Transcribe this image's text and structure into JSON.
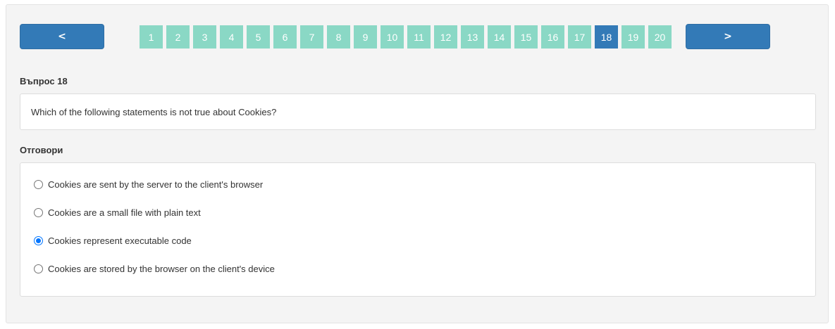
{
  "navigation": {
    "prev_label": "<",
    "next_label": ">",
    "pages": [
      "1",
      "2",
      "3",
      "4",
      "5",
      "6",
      "7",
      "8",
      "9",
      "10",
      "11",
      "12",
      "13",
      "14",
      "15",
      "16",
      "17",
      "18",
      "19",
      "20"
    ],
    "active_page": "18",
    "colors": {
      "button": "#337ab7",
      "page": "#8ad8c5",
      "active_page": "#337ab7"
    }
  },
  "question": {
    "heading": "Въпрос 18",
    "text": "Which of the following statements is not true about Cookies?"
  },
  "answers": {
    "heading": "Отговори",
    "options": [
      {
        "label": "Cookies are sent by the server to the client's browser",
        "checked": false
      },
      {
        "label": "Cookies are a small file with plain text",
        "checked": false
      },
      {
        "label": "Cookies represent executable code",
        "checked": true
      },
      {
        "label": "Cookies are stored by the browser on the client's device",
        "checked": false
      }
    ]
  }
}
